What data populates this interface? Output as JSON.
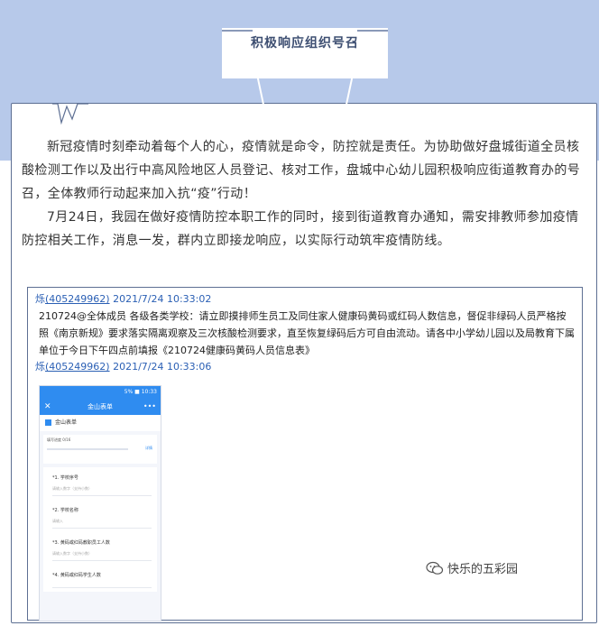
{
  "title": "积极响应组织号召",
  "paragraphs": [
    "新冠疫情时刻牵动着每个人的心，疫情就是命令，防控就是责任。为协助做好盘城街道全员核酸检测工作以及出行中高风险地区人员登记、核对工作，盘城中心幼儿园积极响应街道教育办的号召，全体教师行动起来加入抗“疫”行动！",
    "7月24日，我园在做好疫情防控本职工作的同时，接到街道教育办通知，需安排教师参加疫情防控相关工作，消息一发，群内立即接龙响应，以实际行动筑牢疫情防线。"
  ],
  "chat": {
    "msg1": {
      "sender": "烁",
      "uid": "(405249962)",
      "time": "2021/7/24 10:33:02",
      "text": "210724@全体成员 各级各类学校：请立即摸排师生员工及同住家人健康码黄码或红码人数信息，督促非绿码人员严格按照《南京新规》要求落实隔离观察及三次核酸检测要求，直至恢复绿码后方可自由流动。请各中小学幼儿园以及局教育下属单位于今日下午四点前填报《210724健康码黄码人员信息表》"
    },
    "msg2": {
      "sender": "烁",
      "uid": "(405249962)",
      "time": "2021/7/24 10:33:06"
    }
  },
  "phone": {
    "status_text": "5% ■ 10:33",
    "nav_title": "金山表单",
    "close_glyph": "✕",
    "more_glyph": "•••",
    "form_title": "金山表单",
    "progress_label": "填写进度 0/16",
    "progress_fraction": 0,
    "progress_btn": "详情",
    "questions": [
      {
        "label": "*1. 学校序号",
        "placeholder": "请输入数字（支持小数）"
      },
      {
        "label": "*2. 学校名称",
        "placeholder": "请输入"
      },
      {
        "label": "*3. 黄码或红码教职员工人数",
        "placeholder": "请输入数字（支持小数）"
      },
      {
        "label": "*4. 黄码或红码学生人数",
        "placeholder": ""
      }
    ]
  },
  "watermark": "快乐的五彩园",
  "colors": {
    "band": "#b7c9ea",
    "frame": "#5d6f93",
    "link": "#2a5fb4",
    "phone_accent": "#2f8cf0"
  }
}
